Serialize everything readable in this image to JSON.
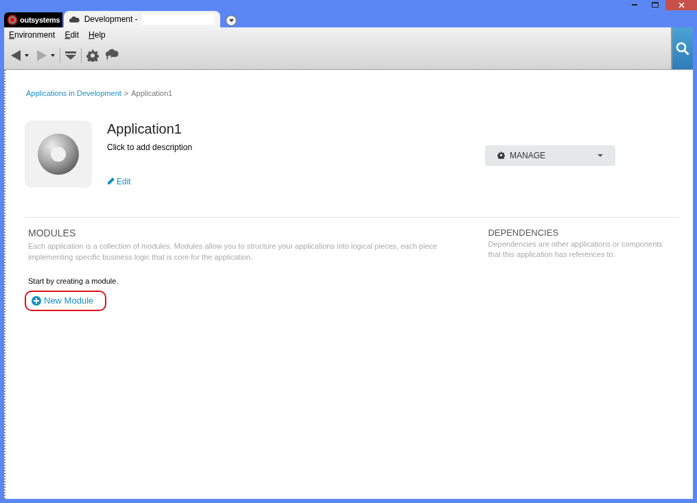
{
  "tabs": [
    {
      "kind": "logo",
      "label": "outsystems",
      "selected": false
    },
    {
      "kind": "page",
      "label": "Development -",
      "selected": true
    }
  ],
  "menu": [
    "Environment",
    "Edit",
    "Help"
  ],
  "breadcrumb": {
    "link": "Applications in Development",
    "separator": ">",
    "current": "Application1"
  },
  "app": {
    "name": "Application1",
    "description": "Click to add description",
    "edit": "Edit",
    "manage": "MANAGE"
  },
  "modules": {
    "title": "MODULES",
    "text": "Each application is a collection of modules. Modules allow you to structure your applications into logical pieces, each piece implementing specific business logic that is core for the application.",
    "hint": "Start by creating a module.",
    "button": "New Module"
  },
  "dependencies": {
    "title": "DEPENDENCIES",
    "text": "Dependencies are other applications or components that this application has references to."
  }
}
